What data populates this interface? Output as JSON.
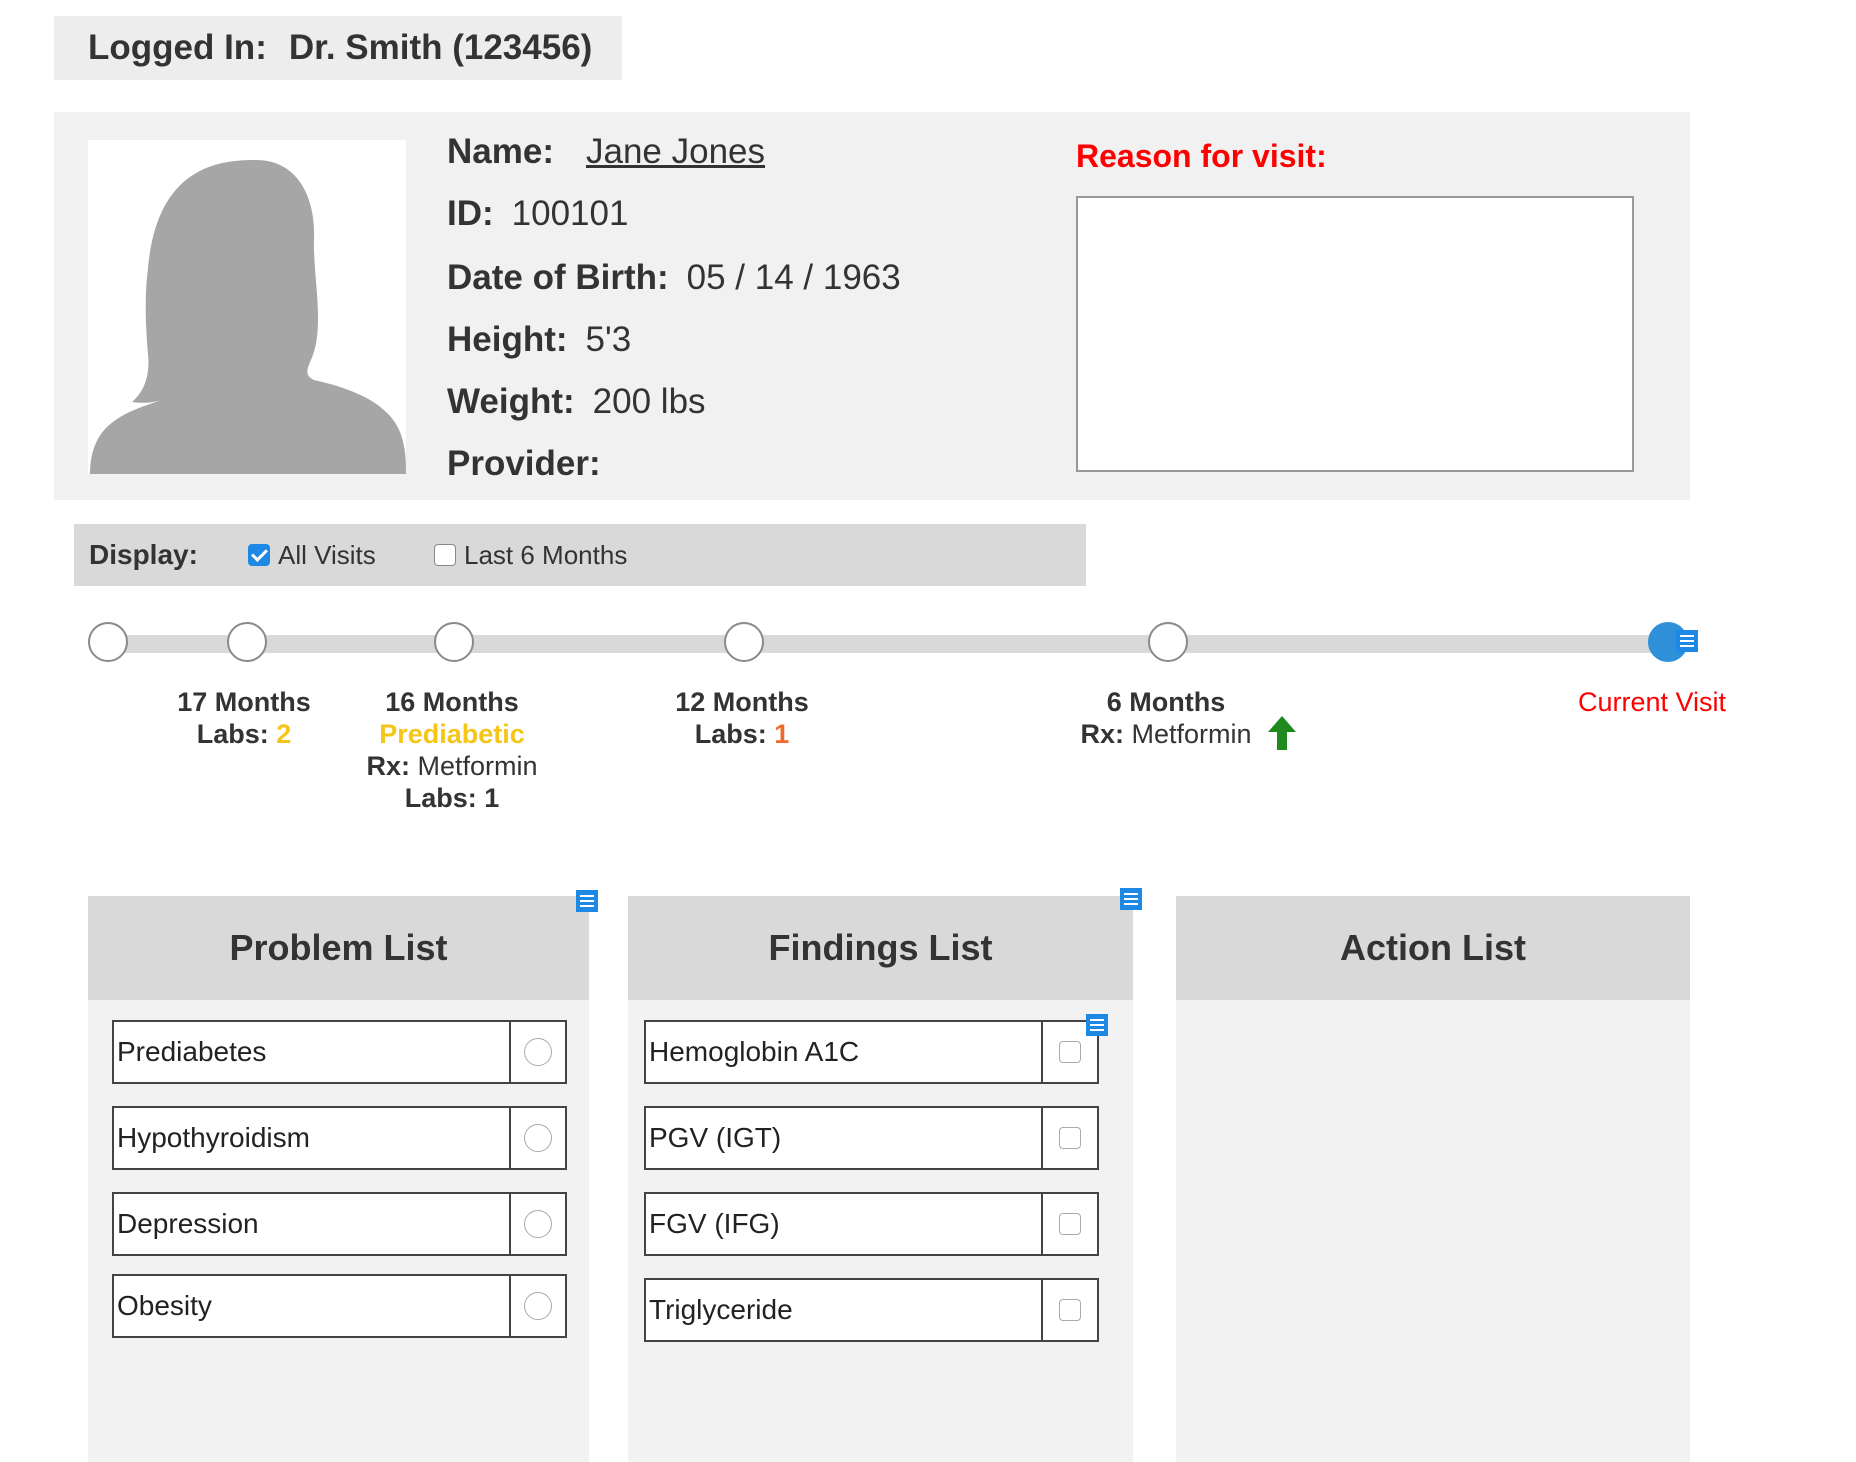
{
  "login": {
    "label": "Logged In:",
    "user": "Dr. Smith (123456)"
  },
  "patient": {
    "name_label": "Name:",
    "name": "Jane Jones",
    "id_label": "ID:",
    "id": "100101",
    "dob_label": "Date of Birth:",
    "dob": "05 / 14 / 1963",
    "height_label": "Height:",
    "height": "5'3",
    "weight_label": "Weight:",
    "weight": "200 lbs",
    "provider_label": "Provider:",
    "provider": "",
    "avatar_icon": "person-silhouette-icon"
  },
  "reason": {
    "label": "Reason for visit:",
    "value": ""
  },
  "display": {
    "label": "Display:",
    "options": [
      {
        "label": "All Visits",
        "checked": true
      },
      {
        "label": "Last 6 Months",
        "checked": false
      }
    ]
  },
  "timeline": {
    "visits": [
      {
        "title": "17 Months",
        "lines": [
          {
            "key": "Labs:",
            "val": "2",
            "color": "#f5c518"
          }
        ]
      },
      {
        "title": "16 Months",
        "status": "Prediabetic",
        "status_color": "#f5c518",
        "rx_key": "Rx:",
        "rx": "Metformin",
        "labs_key": "Labs:",
        "labs": "1"
      },
      {
        "title": "12 Months",
        "lines": [
          {
            "key": "Labs:",
            "val": "1",
            "color": "#f06b2b"
          }
        ]
      },
      {
        "title": "6 Months",
        "rx_key": "Rx:",
        "rx": "Metformin",
        "trend_icon": "arrow-up-icon",
        "trend_color": "#1e8a1e"
      },
      {
        "title": "Current Visit",
        "color": "#ff0000"
      }
    ]
  },
  "problem_list": {
    "title": "Problem List",
    "items": [
      "Prediabetes",
      "Hypothyroidism",
      "Depression",
      "Obesity"
    ]
  },
  "findings_list": {
    "title": "Findings List",
    "items": [
      "Hemoglobin A1C",
      "PGV (IGT)",
      "FGV (IFG)",
      "Triglyceride"
    ]
  },
  "action_list": {
    "title": "Action List",
    "items": []
  },
  "colors": {
    "accent": "#1e88e5",
    "current_node": "#2e90d8",
    "alert": "#ff0000"
  }
}
